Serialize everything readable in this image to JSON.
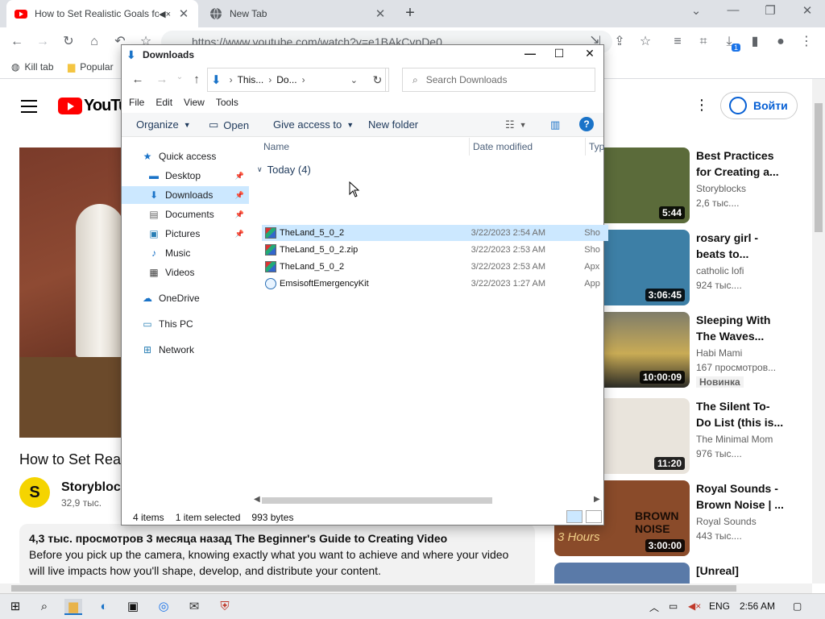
{
  "browser": {
    "tabs": [
      {
        "title": "How to Set Realistic Goals for Y"
      },
      {
        "title": "New Tab"
      }
    ],
    "url": "https://www.youtube.com/watch?v=e1BAkCvpDe0",
    "bookmarks": [
      {
        "label": "Kill tab"
      },
      {
        "label": "Popular"
      }
    ],
    "download_count": "1"
  },
  "youtube": {
    "logo_text": "YouTube",
    "signin_label": "Войти",
    "video_title": "How to Set Rea",
    "channel_letter": "S",
    "channel_name": "Storyblock",
    "channel_subs": "32,9 тыс.",
    "desc_meta": "4,3 тыс. просмотров  3 месяца назад  The Beginner's Guide to Creating Video",
    "desc_text": "Before you pick up the camera, knowing exactly what you want to achieve and where your video will live impacts how you'll shape, develop, and distribute your content.",
    "recs": [
      {
        "title": "Best Practices for Creating a...",
        "channel": "Storyblocks",
        "views": "2,6 тыс....",
        "duration": "5:44",
        "color": "#5b6b3a"
      },
      {
        "title": "rosary girl - beats to...",
        "channel": "catholic lofi",
        "views": "924 тыс....",
        "duration": "3:06:45",
        "color": "#3d7fa6"
      },
      {
        "title": "Sleeping With The Waves...",
        "channel": "Habi Mami",
        "views": "167 просмотров...",
        "duration": "10:00:09",
        "badge": "Новинка",
        "color": "#a38a4a"
      },
      {
        "title": "The Silent To-Do List (this is...",
        "channel": "The Minimal Mom",
        "views": "976 тыс....",
        "duration": "11:20",
        "color": "#e9e4dc"
      },
      {
        "title": "Royal Sounds - Brown Noise | ...",
        "channel": "Royal Sounds",
        "views": "443 тыс....",
        "duration": "3:00:00",
        "color": "#8a4b2a",
        "thumb_text": "BROWN NOISE",
        "thumb_sub": "3 Hours"
      },
      {
        "title": "[Unreal]",
        "channel": "",
        "views": "",
        "duration": "",
        "color": "#5a7aa8"
      }
    ]
  },
  "explorer": {
    "title": "Downloads",
    "path": [
      "This...",
      "Do..."
    ],
    "search_placeholder": "Search Downloads",
    "menu": [
      "File",
      "Edit",
      "View",
      "Tools"
    ],
    "commands": {
      "organize": "Organize",
      "open": "Open",
      "give_access": "Give access to",
      "new_folder": "New folder"
    },
    "tree": [
      {
        "label": "Quick access",
        "icon": "star-icon"
      },
      {
        "label": "Desktop",
        "icon": "desktop-icon",
        "pinned": true
      },
      {
        "label": "Downloads",
        "icon": "download-icon",
        "pinned": true,
        "selected": true
      },
      {
        "label": "Documents",
        "icon": "document-icon",
        "pinned": true
      },
      {
        "label": "Pictures",
        "icon": "picture-icon",
        "pinned": true
      },
      {
        "label": "Music",
        "icon": "music-icon"
      },
      {
        "label": "Videos",
        "icon": "video-icon"
      },
      {
        "label": "OneDrive",
        "icon": "cloud-icon"
      },
      {
        "label": "This PC",
        "icon": "pc-icon"
      },
      {
        "label": "Network",
        "icon": "network-icon"
      }
    ],
    "columns": {
      "name": "Name",
      "date": "Date modified",
      "type": "Typ"
    },
    "group": "Today (4)",
    "files": [
      {
        "name": "TheLand_5_0_2",
        "date": "3/22/2023 2:54 AM",
        "type": "Sho",
        "selected": true
      },
      {
        "name": "TheLand_5_0_2.zip",
        "date": "3/22/2023 2:53 AM",
        "type": "Sho"
      },
      {
        "name": "TheLand_5_0_2",
        "date": "3/22/2023 2:53 AM",
        "type": "Apx"
      },
      {
        "name": "EmsisoftEmergencyKit",
        "date": "3/22/2023 1:27 AM",
        "type": "App"
      }
    ],
    "status": {
      "items": "4 items",
      "selected": "1 item selected",
      "size": "993 bytes"
    }
  },
  "taskbar": {
    "lang": "ENG",
    "time": "2:56 AM"
  }
}
